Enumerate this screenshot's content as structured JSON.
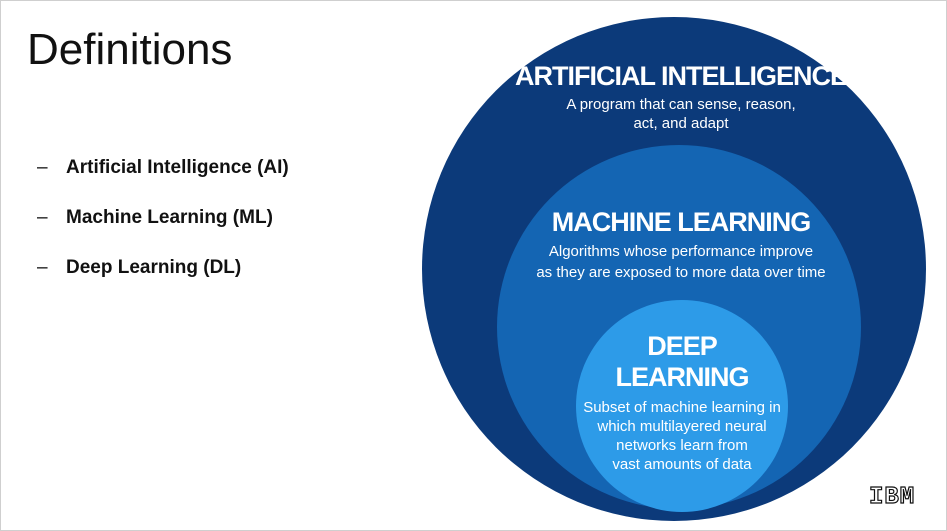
{
  "slide": {
    "title": "Definitions",
    "bullets": [
      {
        "dash": "–",
        "text": "Artificial Intelligence (AI)"
      },
      {
        "dash": "–",
        "text": "Machine Learning (ML)"
      },
      {
        "dash": "–",
        "text": "Deep Learning (DL)"
      }
    ]
  },
  "diagram": {
    "ai": {
      "heading": "ARTIFICIAL INTELLIGENCE",
      "desc_lines": [
        "A program that can sense, reason,",
        "act, and adapt"
      ],
      "color": "#0c3a7a"
    },
    "ml": {
      "heading": "MACHINE LEARNING",
      "desc_lines": [
        "Algorithms whose performance improve",
        "as they are exposed to more data over time"
      ],
      "color": "#1465b3"
    },
    "dl": {
      "heading_lines": [
        "DEEP",
        "LEARNING"
      ],
      "desc_lines": [
        "Subset of machine learning in",
        "which multilayered neural",
        "networks learn from",
        "vast amounts of data"
      ],
      "color": "#2d9be8"
    }
  },
  "logo": {
    "text": "IBM"
  }
}
